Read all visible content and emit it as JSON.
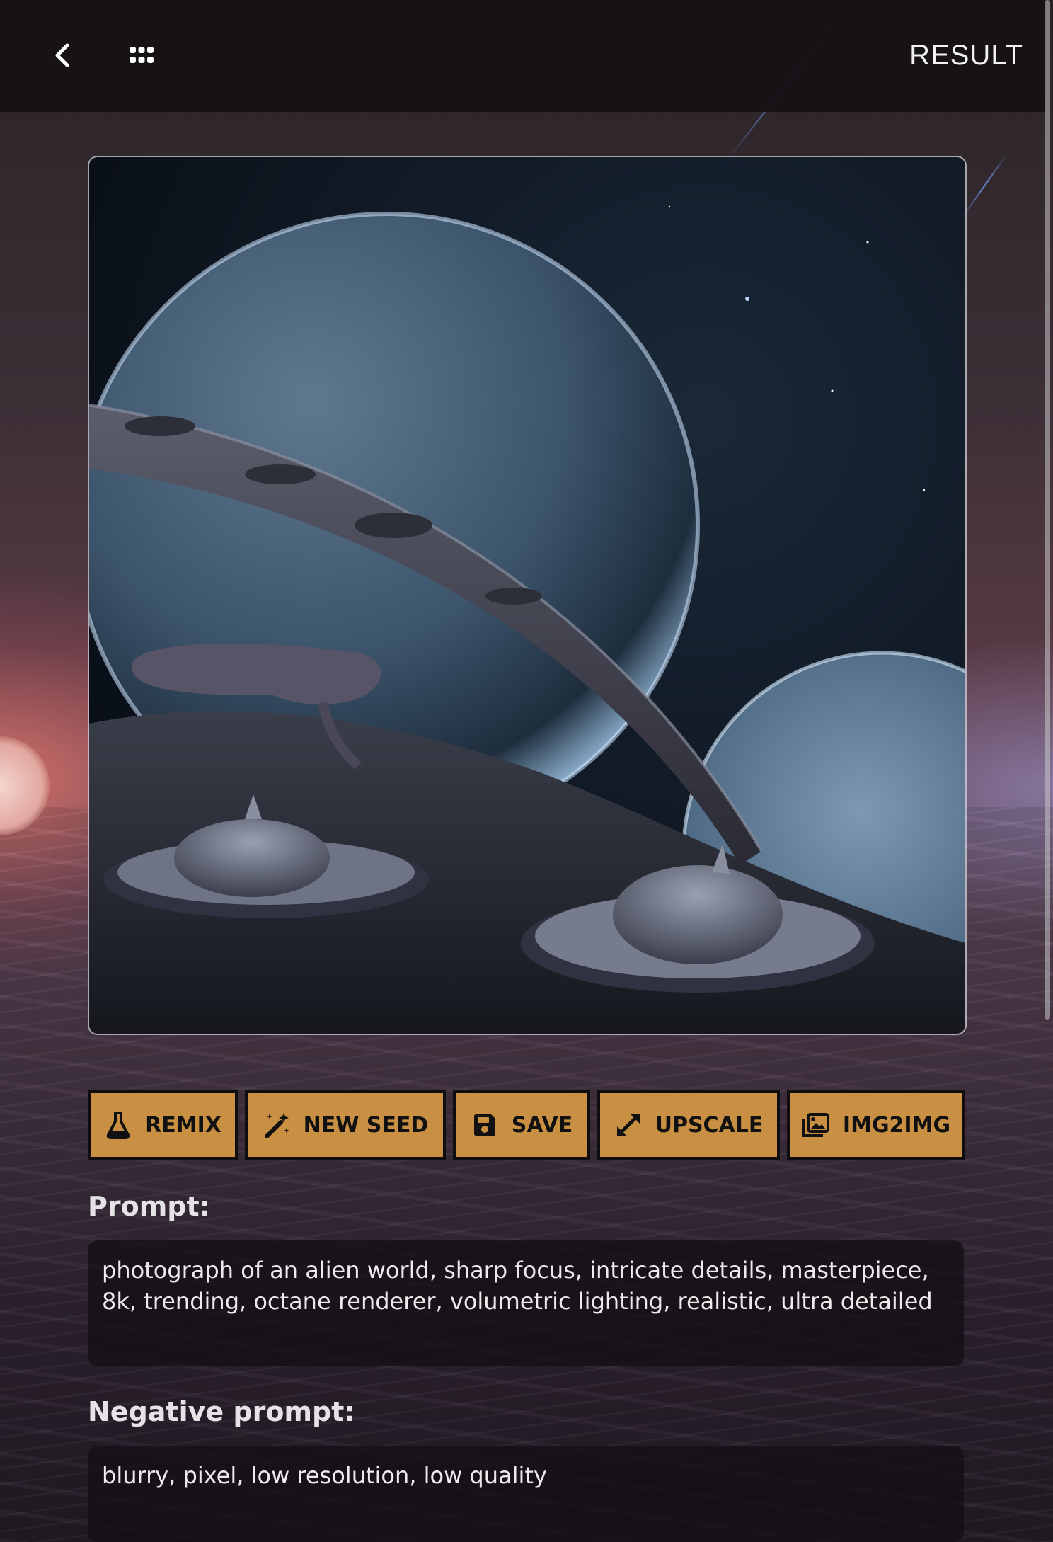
{
  "header": {
    "title": "RESULT",
    "back_icon": "chevron-left-icon",
    "menu_icon": "grid-menu-icon"
  },
  "image": {
    "alt": "photograph of an alien world",
    "icon": "generated-image"
  },
  "actions": [
    {
      "label": "REMIX",
      "icon": "flask-icon"
    },
    {
      "label": "NEW SEED",
      "icon": "magic-wand-icon"
    },
    {
      "label": "SAVE",
      "icon": "floppy-disk-icon"
    },
    {
      "label": "UPSCALE",
      "icon": "expand-arrows-icon"
    },
    {
      "label": "IMG2IMG",
      "icon": "images-icon"
    }
  ],
  "prompt": {
    "label": "Prompt:",
    "value": "photograph of an alien world, sharp focus, intricate details, masterpiece, 8k, trending, octane renderer, volumetric lighting, realistic, ultra detailed"
  },
  "negative_prompt": {
    "label": "Negative prompt:",
    "value": "blurry, pixel, low resolution, low quality"
  },
  "colors": {
    "button_bg": "#c99043",
    "button_border": "#0f0d0f",
    "topbar_bg": "#161216",
    "text_light": "#f2f2f2"
  }
}
